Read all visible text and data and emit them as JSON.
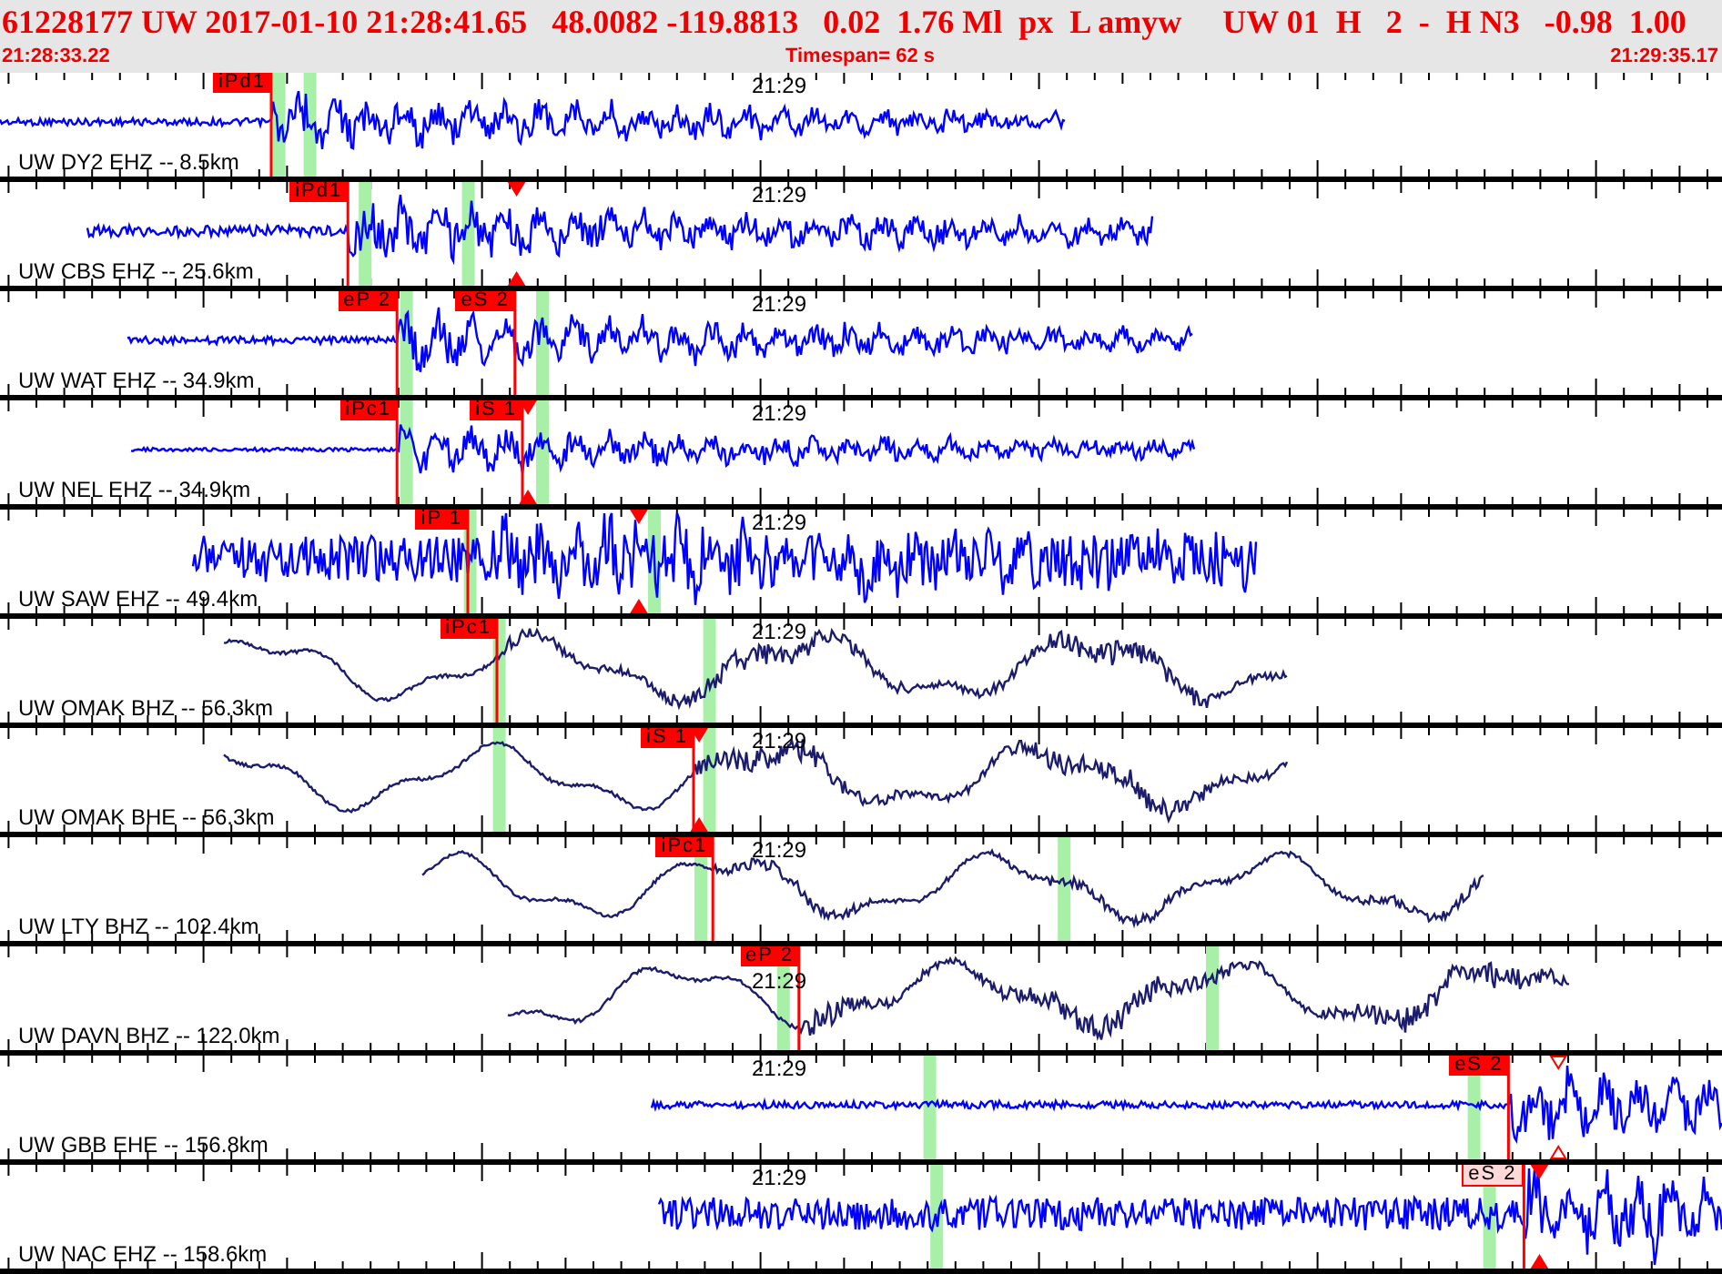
{
  "header": {
    "event_line": "61228177 UW 2017-01-10 21:28:41.65   48.0082 -119.8813   0.02  1.76 Ml  px  L amyw     UW 01  H   2  -  H N3   -0.98  1.00",
    "start_time": "21:28:33.22",
    "timespan": "Timespan=  62 s",
    "end_time": "21:29:35.17"
  },
  "traces": [
    {
      "label": "UW DY2 EHZ -- 8.5km",
      "minute_label": "21:29",
      "color": "#0000ff",
      "picks": [
        {
          "label": "iPd1",
          "kind": "solid",
          "level": 0.1575
        }
      ],
      "bands": [
        {
          "level": 0.162
        },
        {
          "level": 0.18
        }
      ]
    },
    {
      "label": "UW CBS EHZ -- 25.6km",
      "minute_label": "21:29",
      "color": "#0000ff",
      "picks": [
        {
          "label": "iPd1",
          "kind": "solid",
          "level": 0.202
        }
      ],
      "bands": [
        {
          "level": 0.212
        },
        {
          "level": 0.272
        }
      ],
      "markers": [
        {
          "kind": "solid",
          "level": 0.3
        }
      ]
    },
    {
      "label": "UW WAT EHZ -- 34.9km",
      "minute_label": "21:29",
      "color": "#0000ff",
      "picks": [
        {
          "label": "eP 2",
          "kind": "solid",
          "level": 0.2305
        },
        {
          "label": "eS 2",
          "kind": "solid",
          "level": 0.299
        }
      ],
      "bands": [
        {
          "level": 0.236
        },
        {
          "level": 0.315
        }
      ]
    },
    {
      "label": "UW NEL EHZ -- 34.9km",
      "minute_label": "21:29",
      "color": "#0000ff",
      "picks": [
        {
          "label": "iPc1",
          "kind": "solid",
          "level": 0.2305
        },
        {
          "label": "iS 1",
          "kind": "solid",
          "level": 0.3034
        }
      ],
      "bands": [
        {
          "level": 0.236
        },
        {
          "level": 0.315
        }
      ],
      "markers": [
        {
          "kind": "solid",
          "level": 0.3066
        }
      ]
    },
    {
      "label": "UW SAW EHZ -- 49.4km",
      "minute_label": "21:29",
      "color": "#0000ff",
      "picks": [
        {
          "label": "iP 1",
          "kind": "solid",
          "level": 0.2717
        }
      ],
      "bands": [
        {
          "level": 0.273
        },
        {
          "level": 0.38
        }
      ],
      "markers": [
        {
          "kind": "solid",
          "level": 0.371
        }
      ]
    },
    {
      "label": "UW OMAK BHZ -- 56.3km",
      "minute_label": "21:29",
      "color": "#1c1c6c",
      "picks": [
        {
          "label": "iPc1",
          "kind": "solid",
          "level": 0.2886
        }
      ],
      "bands": [
        {
          "level": 0.29
        },
        {
          "level": 0.412
        }
      ]
    },
    {
      "label": "UW OMAK BHE -- 56.3km",
      "minute_label": "21:29",
      "color": "#1c1c6c",
      "picks": [
        {
          "label": "iS 1",
          "kind": "solid",
          "level": 0.4027
        }
      ],
      "bands": [
        {
          "level": 0.29
        },
        {
          "level": 0.412
        }
      ],
      "markers": [
        {
          "kind": "solid",
          "level": 0.406
        }
      ]
    },
    {
      "label": "UW LTY BHZ -- 102.4km",
      "minute_label": "21:29",
      "color": "#1c1c6c",
      "picks": [
        {
          "label": "iPc1",
          "kind": "solid",
          "level": 0.414
        }
      ],
      "bands": [
        {
          "level": 0.407
        },
        {
          "level": 0.618
        }
      ]
    },
    {
      "label": "UW DAVN BHZ -- 122.0km",
      "minute_label": "21:29",
      "color": "#1c1c6c",
      "picks": [
        {
          "label": "eP 2",
          "kind": "solid",
          "level": 0.464
        }
      ],
      "bands": [
        {
          "level": 0.455
        },
        {
          "level": 0.704
        }
      ]
    },
    {
      "label": "UW GBB EHE -- 156.8km",
      "minute_label": "21:29",
      "color": "#0000ff",
      "picks": [
        {
          "label": "eS 2",
          "kind": "solid",
          "level": 0.876
        }
      ],
      "bands": [
        {
          "level": 0.54
        },
        {
          "level": 0.856
        }
      ],
      "markers": [
        {
          "kind": "hollow",
          "level": 0.905
        }
      ]
    },
    {
      "label": "UW NAC EHZ -- 158.6km",
      "minute_label": "21:29",
      "color": "#0000ff",
      "picks": [
        {
          "label": "eS 2",
          "kind": "hollow",
          "level": 0.885
        }
      ],
      "bands": [
        {
          "level": 0.544
        },
        {
          "level": 0.865
        }
      ],
      "markers": [
        {
          "kind": "solid",
          "level": 0.894
        }
      ]
    }
  ]
}
